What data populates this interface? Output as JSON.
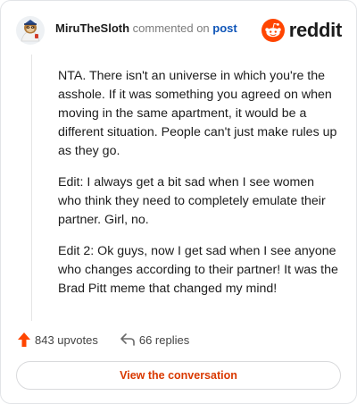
{
  "header": {
    "username": "MiruTheSloth",
    "action_text": "commented on",
    "post_link": "post"
  },
  "brand": {
    "logo_text": "reddit",
    "color": "#ff4500"
  },
  "comment": {
    "paragraphs": [
      "NTA. There isn't an universe in which you're the asshole. If it was something you agreed on when moving in the same apartment, it would be a different situation. People can't just make rules up as they go.",
      "Edit: I always get a bit sad when I see women who think they need to completely emulate their partner. Girl, no.",
      "Edit 2: Ok guys, now I get sad when I see anyone who changes according to their partner! It was the Brad Pitt meme that changed my mind!"
    ]
  },
  "actions": {
    "upvotes": "843 upvotes",
    "replies": "66 replies",
    "upvote_icon": "upvote-arrow-icon",
    "reply_icon": "reply-arrow-icon"
  },
  "footer": {
    "button_label": "View the conversation",
    "button_color": "#d93900"
  }
}
